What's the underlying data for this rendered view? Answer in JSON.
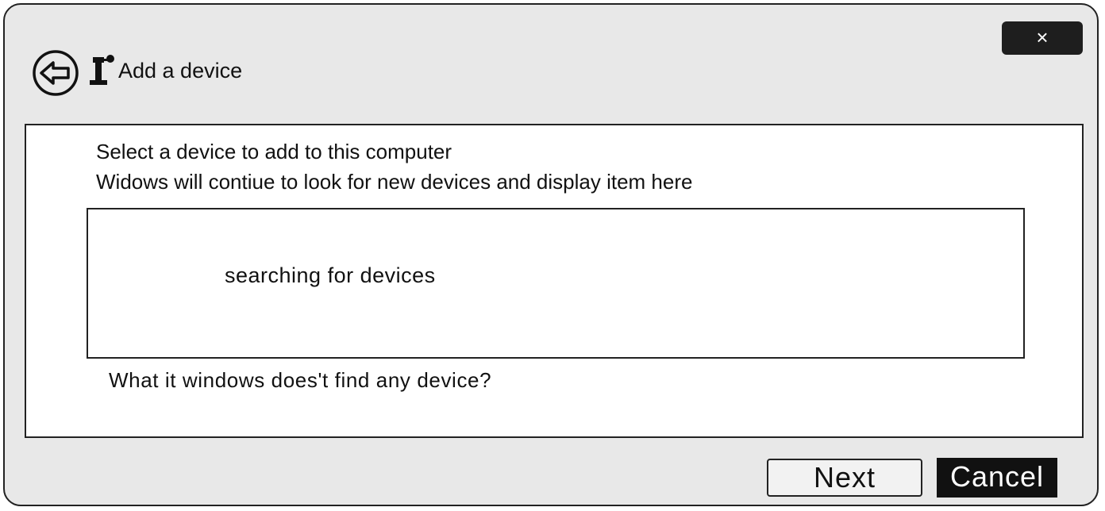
{
  "window": {
    "title": "Add a device",
    "close_label": "×"
  },
  "content": {
    "heading": "Select a device to add to this computer",
    "subheading": "Widows will contiue to look for new devices and display item here",
    "device_list": {
      "status": "searching for devices"
    },
    "help_link": "What it windows does't find any device?"
  },
  "footer": {
    "next_label": "Next",
    "cancel_label": "Cancel"
  },
  "icons": {
    "back": "back-arrow-icon",
    "device": "device-icon",
    "close": "close-icon"
  },
  "colors": {
    "window_background": "#e8e8e8",
    "close_button": "#1e1e1e",
    "cancel_button": "#111111",
    "border": "#222222"
  }
}
